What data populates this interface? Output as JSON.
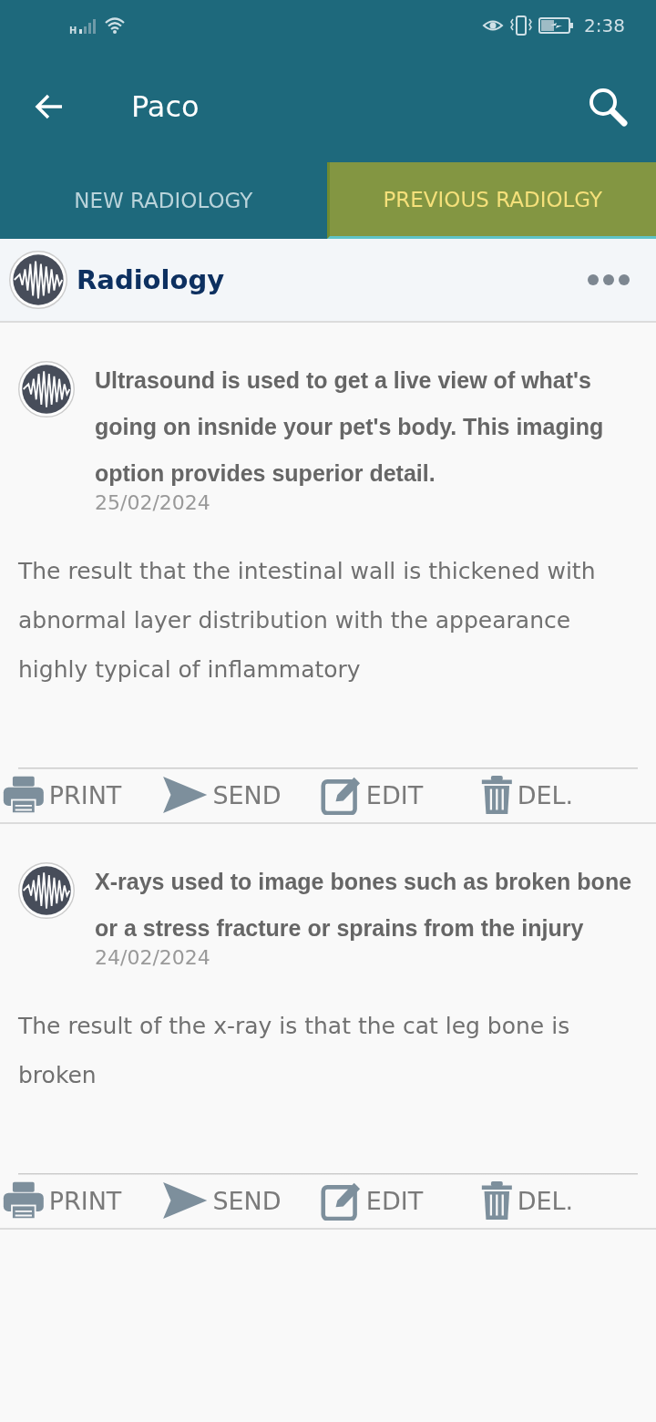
{
  "status_bar": {
    "network": "H",
    "time": "2:38"
  },
  "app_bar": {
    "title": "Paco"
  },
  "tabs": [
    {
      "label": "NEW RADIOLOGY",
      "selected": false
    },
    {
      "label": "PREVIOUS RADIOLGY",
      "selected": true
    }
  ],
  "section": {
    "title": "Radiology"
  },
  "records": [
    {
      "title": "Ultrasound is used to get a live view of what's going on insnide your pet's body. This imaging option provides superior detail.",
      "date": "25/02/2024",
      "result": "The result that the intestinal wall is thickened with abnormal layer distribution with the appearance highly typical of inflammatory",
      "actions": [
        {
          "kind": "print",
          "label": "PRINT"
        },
        {
          "kind": "send",
          "label": "SEND"
        },
        {
          "kind": "edit",
          "label": "EDIT"
        },
        {
          "kind": "delete",
          "label": "DEL."
        }
      ]
    },
    {
      "title": "X-rays used to image bones such as broken bone or a stress fracture or sprains from the injury",
      "date": "24/02/2024",
      "result": "The result of the x-ray is that the cat leg bone is broken",
      "actions": [
        {
          "kind": "print",
          "label": "PRINT"
        },
        {
          "kind": "send",
          "label": "SEND"
        },
        {
          "kind": "edit",
          "label": "EDIT"
        },
        {
          "kind": "delete",
          "label": "DEL."
        }
      ]
    }
  ]
}
